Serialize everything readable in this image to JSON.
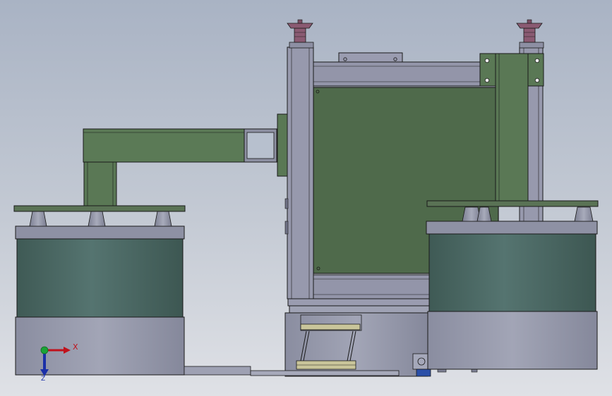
{
  "viewport": {
    "triad": {
      "x_label": "X",
      "z_label": "Z",
      "x_color": "#c0121c",
      "z_color": "#1b2fa8",
      "y_color": "#1aa336"
    }
  },
  "colors": {
    "frame_gray": "#8c8ea3",
    "frame_light": "#a3a5b8",
    "base_gray": "#979aad",
    "panel_green": "#4f6a4b",
    "arm_green": "#5b7a56",
    "drum_teal": "#4b6762",
    "foot_mauve": "#8a5a72",
    "outline": "#1a1a1a"
  }
}
